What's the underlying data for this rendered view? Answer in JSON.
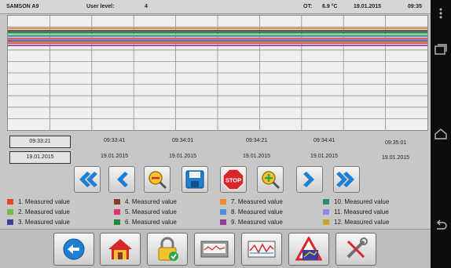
{
  "status": {
    "device": "SAMSON A9",
    "user_level_label": "User level:",
    "user_level_value": "4",
    "ot_label": "OT:",
    "ot_value": "6.9 °C",
    "date": "19.01.2015",
    "time": "09:35"
  },
  "chart_data": {
    "type": "line",
    "title": "",
    "xlabel": "",
    "ylabel": "",
    "grid": true,
    "x": [
      "09:33:21",
      "09:33:41",
      "09:34:01",
      "09:34:21",
      "09:34:41",
      "09:35:01"
    ],
    "ylim": [
      0,
      100
    ],
    "series": [
      {
        "name": "1. Measured value",
        "values": [
          80,
          80,
          80,
          80,
          80,
          80
        ]
      },
      {
        "name": "2. Measured value",
        "values": [
          83,
          83,
          83,
          83,
          83,
          83
        ]
      },
      {
        "name": "3. Measured value",
        "values": [
          78,
          78,
          78,
          78,
          78,
          78
        ]
      },
      {
        "name": "4. Measured value",
        "values": [
          87,
          87,
          87,
          87,
          87,
          87
        ]
      },
      {
        "name": "5. Measured value",
        "values": [
          76,
          76,
          76,
          76,
          76,
          76
        ]
      },
      {
        "name": "6. Measured value",
        "values": [
          85,
          85,
          85,
          85,
          85,
          85
        ]
      },
      {
        "name": "7. Measured value",
        "values": [
          89,
          89,
          89,
          89,
          89,
          89
        ]
      },
      {
        "name": "8. Measured value",
        "values": [
          82,
          82,
          82,
          82,
          82,
          82
        ]
      },
      {
        "name": "9. Measured value",
        "values": [
          74,
          74,
          74,
          74,
          74,
          74
        ]
      },
      {
        "name": "10. Measured value",
        "values": [
          86,
          86,
          86,
          86,
          86,
          86
        ]
      },
      {
        "name": "11. Measured value",
        "values": [
          79,
          79,
          79,
          79,
          79,
          79
        ]
      },
      {
        "name": "12. Measured value",
        "values": [
          77,
          77,
          77,
          77,
          77,
          77
        ]
      }
    ]
  },
  "time_axis": {
    "current_time": "09:33:21",
    "current_date": "19.01.2015",
    "ticks": [
      {
        "time": "09:33:41",
        "date": "19.01.2015"
      },
      {
        "time": "09:34:01",
        "date": "19.01.2015"
      },
      {
        "time": "09:34:21",
        "date": "19.01.2015"
      },
      {
        "time": "09:34:41",
        "date": "19.01.2015"
      },
      {
        "time": "09:35:01",
        "date": "19.01.2015"
      }
    ]
  },
  "legend": [
    {
      "label": "1. Measured value",
      "color": "#e8452a"
    },
    {
      "label": "2. Measured value",
      "color": "#6cc04a"
    },
    {
      "label": "3. Measured value",
      "color": "#3b3f9e"
    },
    {
      "label": "4. Measured value",
      "color": "#8b3a2a"
    },
    {
      "label": "5. Measured value",
      "color": "#e0336a"
    },
    {
      "label": "6. Measured value",
      "color": "#1f8a3a"
    },
    {
      "label": "7. Measured value",
      "color": "#f08a2a"
    },
    {
      "label": "8. Measured value",
      "color": "#4a8ed8"
    },
    {
      "label": "9. Measured value",
      "color": "#9a3a9a"
    },
    {
      "label": "10. Measured value",
      "color": "#2a8a7a"
    },
    {
      "label": "11. Measured value",
      "color": "#8a8ae0"
    },
    {
      "label": "12. Measured value",
      "color": "#c9a52a"
    }
  ],
  "nav_buttons": {
    "fast_back": "double-chevron-left-icon",
    "back": "chevron-left-icon",
    "zoom_out": "zoom-out-icon",
    "save": "floppy-disk-icon",
    "stop": "STOP",
    "zoom_in": "zoom-in-icon",
    "forward": "chevron-right-icon",
    "fast_forward": "double-chevron-right-icon"
  },
  "toolbar": [
    "back-arrow-icon",
    "home-icon",
    "padlock-icon",
    "recorder-icon",
    "trend-icon",
    "warning-icon",
    "tools-icon"
  ],
  "colors": {
    "accent_blue": "#1f7fd0",
    "stop_red": "#d8262a"
  }
}
